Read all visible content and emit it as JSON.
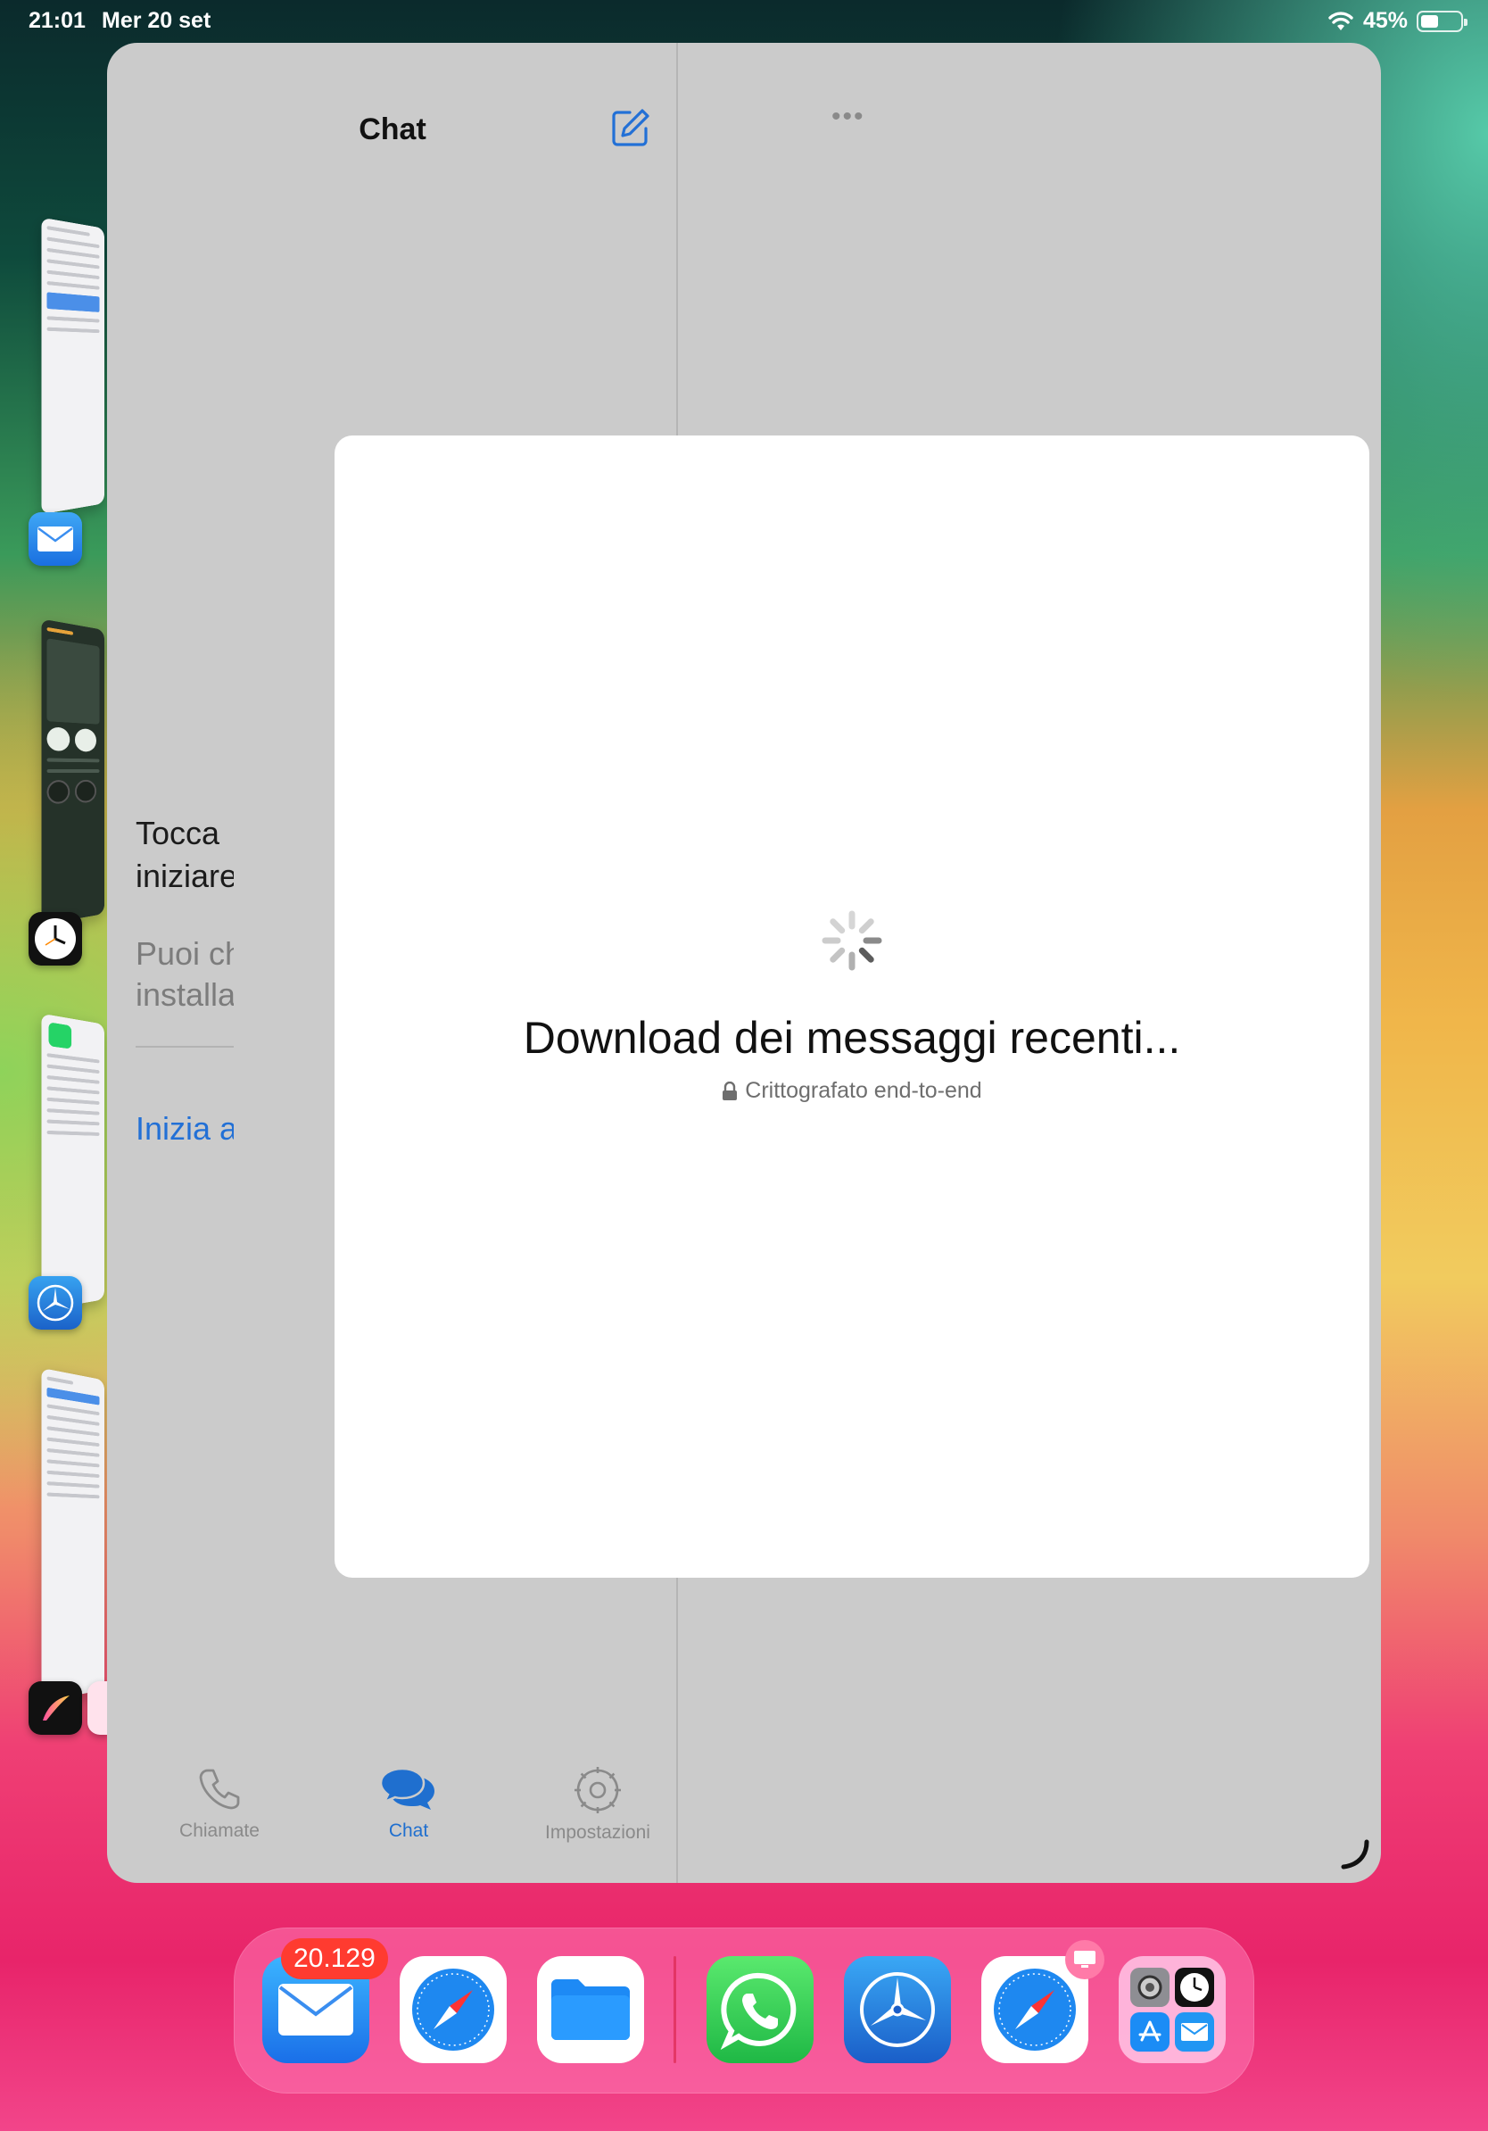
{
  "status": {
    "time": "21:01",
    "date": "Mer 20 set",
    "battery": "45%",
    "battery_level": 0.45
  },
  "sidebar": {
    "title": "Chat",
    "placeholder_title": "Tocca\niniziare",
    "placeholder_sub": "Puoi ch\ninstalla",
    "start_link": "Inizia a"
  },
  "tabs": [
    {
      "label": "Chiamate",
      "icon": "phone-icon"
    },
    {
      "label": "Chat",
      "icon": "chat-bubbles-icon"
    },
    {
      "label": "Impostazioni",
      "icon": "gear-icon"
    }
  ],
  "modal": {
    "title": "Download dei messaggi recenti...",
    "subtitle": "Crittografato end-to-end"
  },
  "dock": {
    "mail_badge": "20.129",
    "apps": [
      "mail-icon",
      "safari-icon",
      "files-icon",
      "whatsapp-icon",
      "testflight-icon",
      "safari-icon",
      "folder-icon"
    ]
  },
  "colors": {
    "accent": "#1f6fcf",
    "badge": "#ff3b30",
    "whatsapp": "#25d366"
  }
}
